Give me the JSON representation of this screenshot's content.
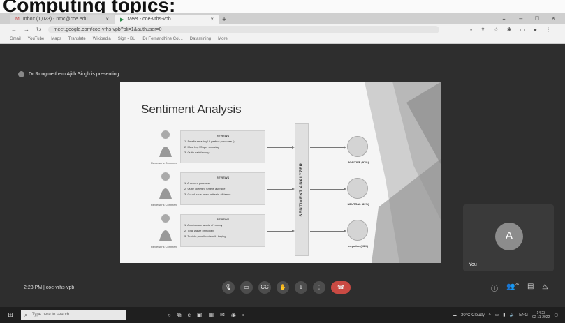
{
  "heading": "Computing topics:",
  "browser": {
    "tabs": [
      {
        "label": "Inbox (1,023) - nmc@coe.edu",
        "active": false
      },
      {
        "label": "Meet - coe-vrhs-vpb",
        "active": true
      }
    ],
    "url": "meet.google.com/coe-vrhs-vpb?pli=1&authuser=0",
    "bookmarks": [
      "Gmail",
      "YouTube",
      "Maps",
      "Translate",
      "Wikipedia",
      "Sign - BU",
      "Dr Fernandhine Col...",
      "Datamining",
      "More"
    ]
  },
  "meet": {
    "presenting_text": "Dr Rongmeithem Ajith Singh is presenting",
    "meeting_time": "2:23 PM",
    "meeting_code": "coe-vrhs-vpb",
    "self_label": "You",
    "self_avatar": "A",
    "participants_badge": "26",
    "controls": [
      "mic-icon",
      "camera-icon",
      "captions-icon",
      "raise-hand-icon",
      "present-icon",
      "more-icon",
      "end-call-icon"
    ],
    "right_controls": [
      "info-icon",
      "people-icon",
      "chat-icon",
      "activities-icon"
    ]
  },
  "slide": {
    "title": "Sentiment Analysis",
    "analyzer_label": "SENTIMENT ANALYZER",
    "reviewer_label": "Reviewer's Comment",
    "rows": [
      {
        "heading": "REVIEWS",
        "lines": [
          "1. Smells amazing! A perfect purchase :)",
          "2. Must buy! Super amazing",
          "3. Quite satisfactory"
        ],
        "result": "POSITIVE (97%)"
      },
      {
        "heading": "REVIEWS",
        "lines": [
          "1. A decent purchase",
          "2. Quite okayish! Smells average",
          "3. Could have been better in all terms"
        ],
        "result": "NEUTRAL (89%)"
      },
      {
        "heading": "REVIEWS",
        "lines": [
          "1. An absolute waste of money",
          "2. Total waste of money",
          "3. Terrible, smell not worth buying"
        ],
        "result": "negative (93%)"
      }
    ]
  },
  "taskbar": {
    "search_placeholder": "Type here to search",
    "weather": "30°C Cloudy",
    "language": "ENG",
    "time": "14:23",
    "date": "02-11-2022"
  },
  "colors": {
    "meet_bg": "#2e2e2e",
    "end_call": "#c94a43",
    "slide_bg": "#f5f5f5"
  }
}
